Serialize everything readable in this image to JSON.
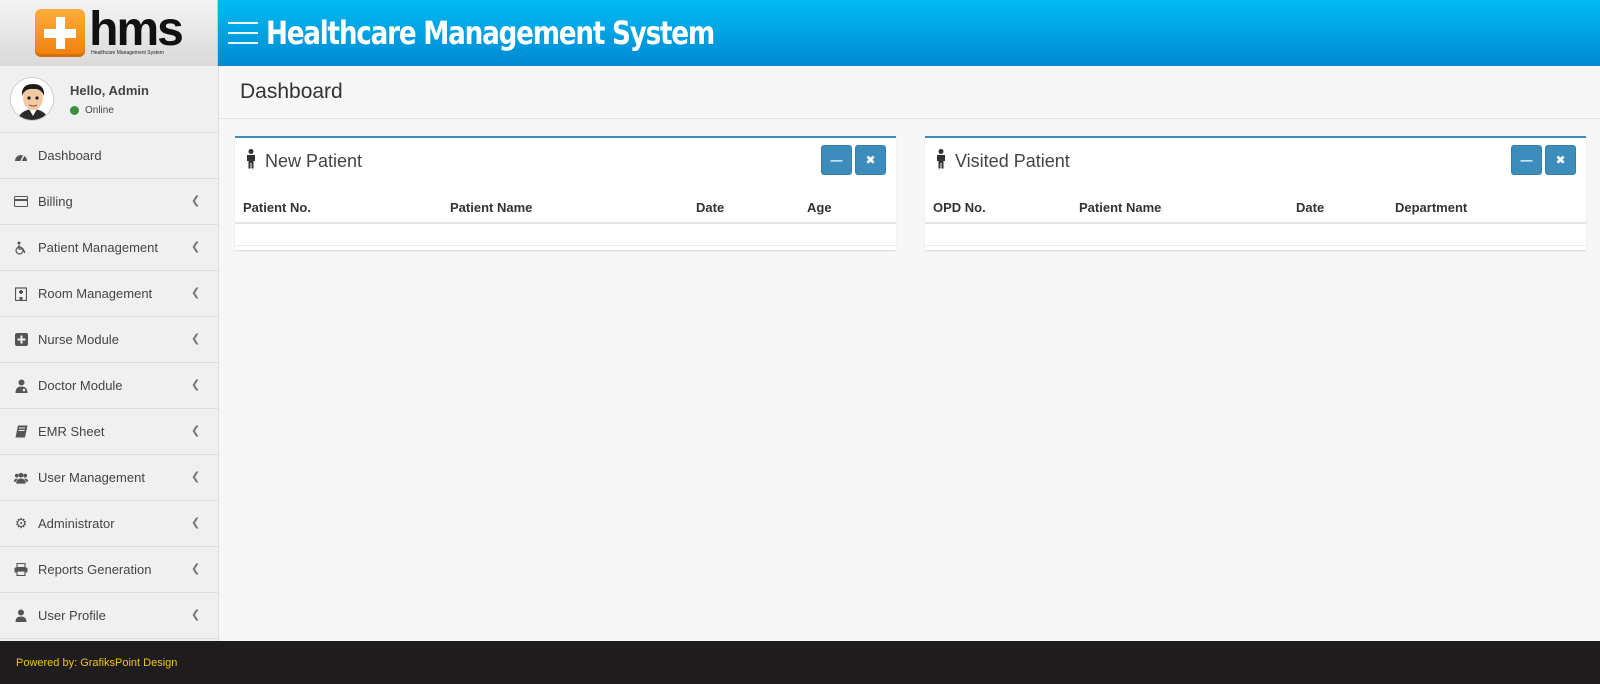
{
  "logo": {
    "word": "hms",
    "subtitle": "Healthcare Management System"
  },
  "header": {
    "title": "Healthcare Management System"
  },
  "user": {
    "greeting": "Hello, Admin",
    "status": "Online"
  },
  "sidebar": {
    "items": [
      {
        "label": "Dashboard",
        "icon": "dashboard-icon",
        "has_submenu": false
      },
      {
        "label": "Billing",
        "icon": "credit-card-icon",
        "has_submenu": true
      },
      {
        "label": "Patient Management",
        "icon": "wheelchair-icon",
        "has_submenu": true
      },
      {
        "label": "Room Management",
        "icon": "hospital-building-icon",
        "has_submenu": true
      },
      {
        "label": "Nurse Module",
        "icon": "plus-square-icon",
        "has_submenu": true
      },
      {
        "label": "Doctor Module",
        "icon": "user-md-icon",
        "has_submenu": true
      },
      {
        "label": "EMR Sheet",
        "icon": "book-icon",
        "has_submenu": true
      },
      {
        "label": "User Management",
        "icon": "users-icon",
        "has_submenu": true
      },
      {
        "label": "Administrator",
        "icon": "gear-icon",
        "has_submenu": true
      },
      {
        "label": "Reports Generation",
        "icon": "printer-icon",
        "has_submenu": true
      },
      {
        "label": "User Profile",
        "icon": "user-icon",
        "has_submenu": true
      }
    ]
  },
  "main": {
    "page_title": "Dashboard",
    "new_patient": {
      "title": "New Patient",
      "columns": [
        "Patient No.",
        "Patient Name",
        "Date",
        "Age"
      ],
      "rows": []
    },
    "visited_patient": {
      "title": "Visited Patient",
      "columns": [
        "OPD No.",
        "Patient Name",
        "Date",
        "Department"
      ],
      "rows": []
    }
  },
  "footer": {
    "text": "Powered by: GrafiksPoint Design"
  },
  "colors": {
    "accent": "#3c8dbc",
    "header_top": "#00bbf2",
    "header_bottom": "#0089d3",
    "footer_text": "#f0c419"
  }
}
